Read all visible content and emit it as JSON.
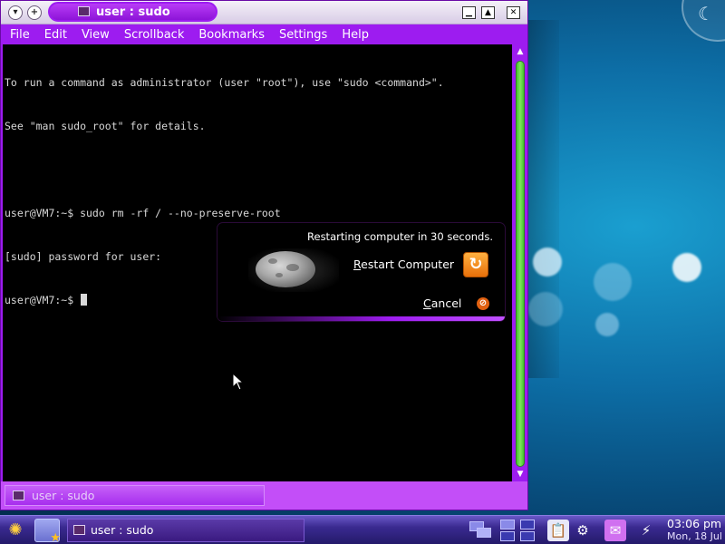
{
  "window": {
    "title": "user : sudo",
    "menu": [
      "File",
      "Edit",
      "View",
      "Scrollback",
      "Bookmarks",
      "Settings",
      "Help"
    ]
  },
  "terminal": {
    "lines": [
      "To run a command as administrator (user \"root\"), use \"sudo <command>\".",
      "See \"man sudo_root\" for details.",
      "",
      "user@VM7:~$ sudo rm -rf / --no-preserve-root",
      "[sudo] password for user:",
      "user@VM7:~$ "
    ]
  },
  "tabbar": {
    "tab_label": "user : sudo"
  },
  "dialog": {
    "message": "Restarting computer in 30 seconds.",
    "restart_first": "R",
    "restart_rest": "estart Computer",
    "cancel_first": "C",
    "cancel_rest": "ancel"
  },
  "taskbar": {
    "task_label": "user : sudo",
    "clock_time": "03:06 pm",
    "clock_date": "Mon, 18 Jul"
  },
  "colors": {
    "window_frame": "#9d1cf0",
    "tab_bar": "#c34ef8",
    "scrollbar": "#48c030",
    "restart_icon": "#e8700a"
  },
  "icons": {
    "launcher": "kde-launcher-icon",
    "restart": "restart-icon",
    "cancel": "cancel-icon"
  }
}
